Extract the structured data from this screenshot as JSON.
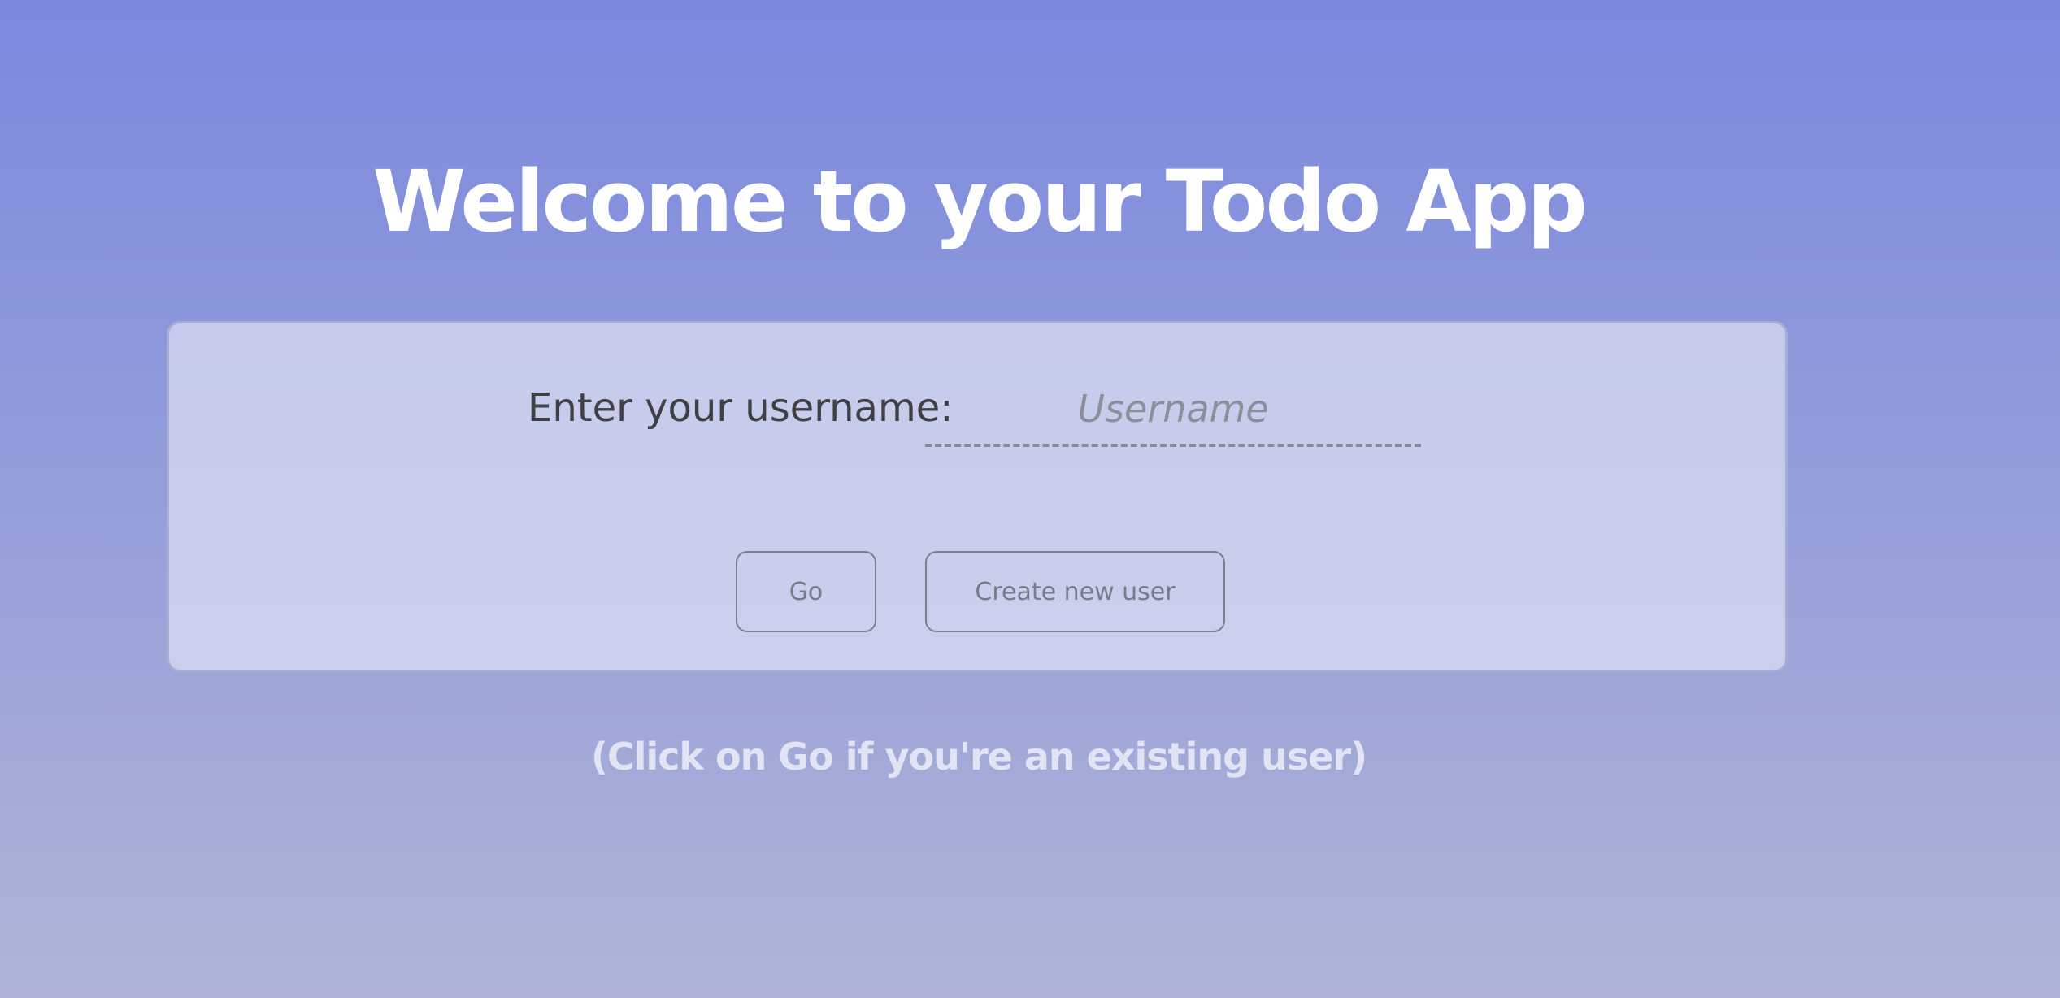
{
  "header": {
    "title": "Welcome to your Todo App"
  },
  "login_form": {
    "username_label": "Enter your username:",
    "username_placeholder": "Username",
    "username_value": "",
    "go_button_label": "Go",
    "create_button_label": "Create new user"
  },
  "hint": {
    "text": "(Click on Go if you're an existing user)"
  },
  "colors": {
    "background_top": "#7b88dd",
    "background_bottom": "#afb4d7",
    "title_text": "#ffffff",
    "card_background": "#d6d9f0",
    "card_border": "#a9acd2",
    "label_text": "#3f3f44",
    "button_border": "#7e7e8e",
    "hint_text": "#e2e4f5"
  }
}
